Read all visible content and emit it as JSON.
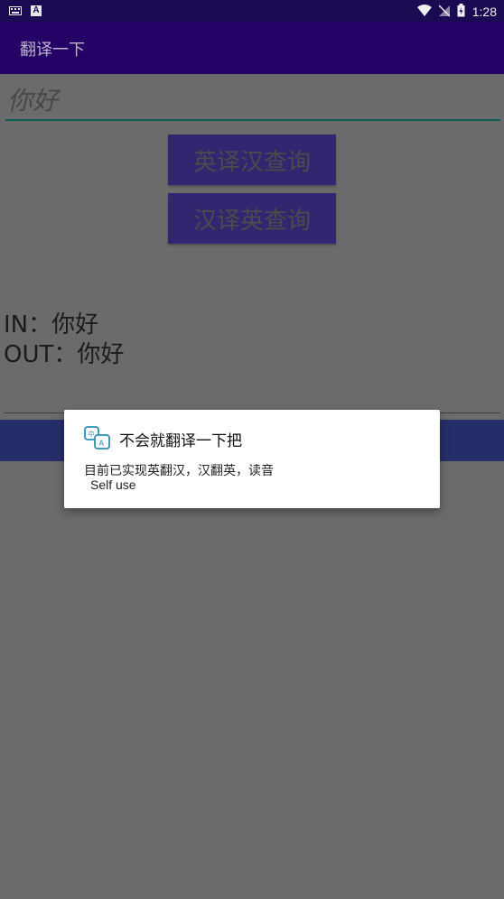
{
  "status_bar": {
    "time": "1:28",
    "notification_letter": "A",
    "icons": [
      "keyboard-icon",
      "app-notification-icon",
      "wifi-icon",
      "no-signal-icon",
      "battery-icon"
    ]
  },
  "app_bar": {
    "title": "翻译一下"
  },
  "input": {
    "value": "你好"
  },
  "buttons": {
    "en_to_zh": "英译汉查询",
    "zh_to_en": "汉译英查询"
  },
  "result": {
    "in_line": "IN：你好",
    "out_line": "OUT：你好"
  },
  "dialog": {
    "title": "不会就翻译一下把",
    "message": "目前已实现英翻汉，汉翻英，读音",
    "subtext": "Self use"
  },
  "colors": {
    "status_bar": "#1a0a52",
    "app_bar": "#240266",
    "button": "#312770",
    "blue_bar": "#262e69",
    "scrim_bg": "#6b6b6b"
  }
}
